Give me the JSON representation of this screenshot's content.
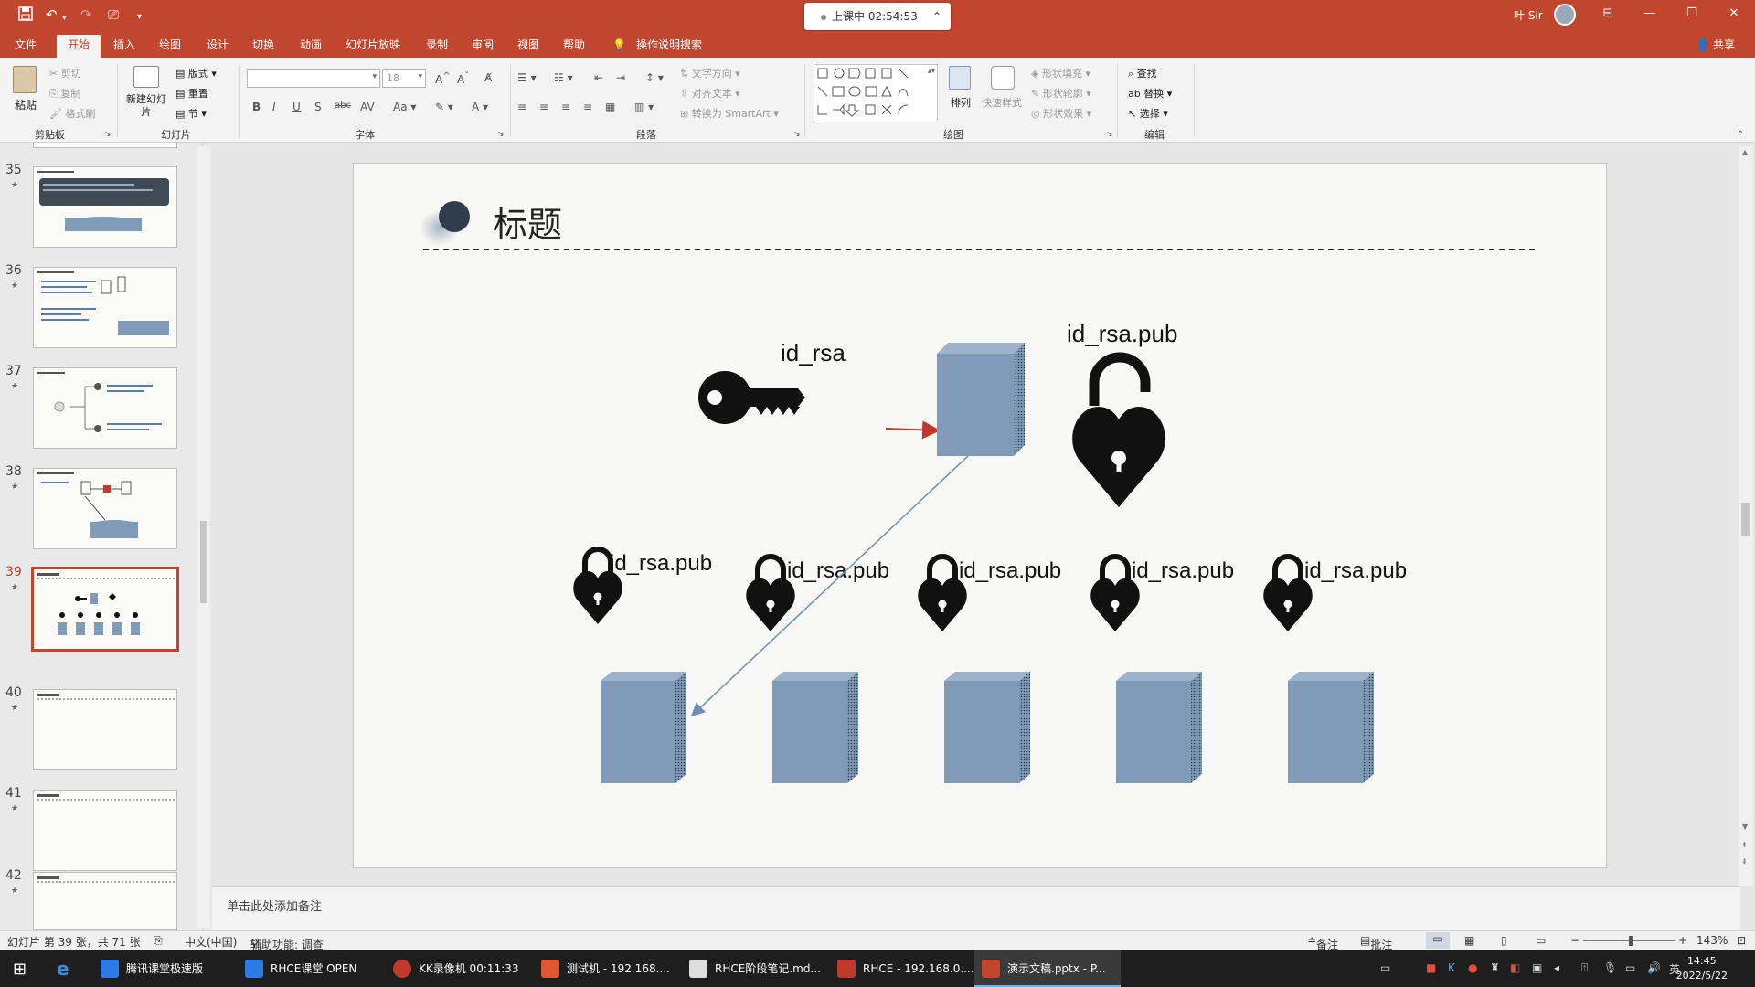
{
  "window": {
    "session_label": "上课中 02:54:53",
    "user": "叶 Sir"
  },
  "tabs": [
    {
      "label": "文件"
    },
    {
      "label": "开始",
      "active": true
    },
    {
      "label": "插入"
    },
    {
      "label": "绘图"
    },
    {
      "label": "设计"
    },
    {
      "label": "切换"
    },
    {
      "label": "动画"
    },
    {
      "label": "幻灯片放映"
    },
    {
      "label": "录制"
    },
    {
      "label": "审阅"
    },
    {
      "label": "视图"
    },
    {
      "label": "帮助"
    },
    {
      "label": "操作说明搜索"
    }
  ],
  "share_label": "共享",
  "ribbon": {
    "clipboard": {
      "paste": "粘贴",
      "cut": "剪切",
      "copy": "复制",
      "format_painter": "格式刷",
      "group": "剪贴板"
    },
    "slides": {
      "new_slide": "新建幻灯片",
      "layout": "版式",
      "reset": "重置",
      "section": "节",
      "group": "幻灯片"
    },
    "font": {
      "font_size": "18",
      "group": "字体"
    },
    "paragraph": {
      "text_direction": "文字方向",
      "align_text": "对齐文本",
      "smartart": "转换为 SmartArt",
      "group": "段落"
    },
    "drawing": {
      "arrange": "排列",
      "quick_styles": "快速样式",
      "shape_fill": "形状填充",
      "shape_outline": "形状轮廓",
      "shape_effects": "形状效果",
      "group": "绘图"
    },
    "editing": {
      "find": "查找",
      "replace": "替换",
      "select": "选择",
      "group": "编辑"
    }
  },
  "thumbnails": [
    {
      "num": "35",
      "selected": false
    },
    {
      "num": "36",
      "selected": false
    },
    {
      "num": "37",
      "selected": false
    },
    {
      "num": "38",
      "selected": false
    },
    {
      "num": "39",
      "selected": true
    },
    {
      "num": "40",
      "selected": false
    },
    {
      "num": "41",
      "selected": false
    },
    {
      "num": "42",
      "selected": false
    }
  ],
  "slide": {
    "title": "标题",
    "private_key_label": "id_rsa",
    "public_key_label": "id_rsa.pub",
    "server_labels": [
      "id_rsa.pub",
      "id_rsa.pub",
      "id_rsa.pub",
      "id_rsa.pub",
      "id_rsa.pub"
    ]
  },
  "notes_placeholder": "单击此处添加备注",
  "status": {
    "slide_info": "幻灯片 第 39 张，共 71 张",
    "language": "中文(中国)",
    "accessibility": "辅助功能: 调查",
    "notes": "备注",
    "comments": "批注",
    "zoom": "143%"
  },
  "taskbar": {
    "items": [
      {
        "label": "腾讯课堂极速版"
      },
      {
        "label": "RHCE课堂 OPEN"
      },
      {
        "label": "KK录像机 00:11:33"
      },
      {
        "label": "测试机 - 192.168...."
      },
      {
        "label": "RHCE阶段笔记.md..."
      },
      {
        "label": "RHCE - 192.168.0...."
      },
      {
        "label": "演示文稿.pptx - P..."
      }
    ],
    "time": "14:45",
    "date": "2022/5/22",
    "ime": "英"
  },
  "colors": {
    "accent": "#c2452d",
    "server_fill": "#7f9bb8",
    "arrow_red": "#c0392b",
    "arrow_blue": "#6e8fb0"
  }
}
